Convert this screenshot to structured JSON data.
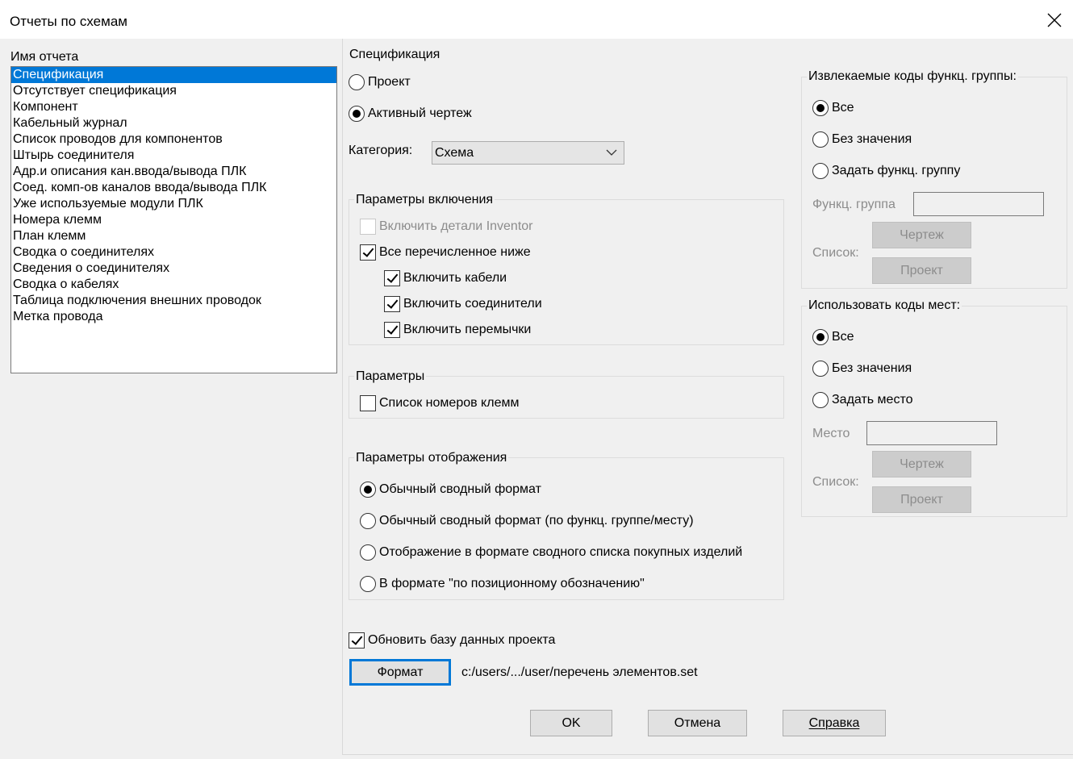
{
  "window": {
    "title": "Отчеты по схемам"
  },
  "report_list": {
    "label": "Имя отчета",
    "selected_index": 0,
    "items": [
      "Спецификация",
      "Отсутствует спецификация",
      "Компонент",
      "Кабельный журнал",
      "Список проводов для компонентов",
      "Штырь соединителя",
      "Адр.и описания кан.ввода/вывода ПЛК",
      "Соед. комп-ов каналов ввода/вывода ПЛК",
      "Уже используемые модули ПЛК",
      "Номера клемм",
      "План клемм",
      "Сводка о соединителях",
      "Сведения о соединителях",
      "Сводка о кабелях",
      "Таблица подключения внешних проводок",
      "Метка провода"
    ]
  },
  "spec": {
    "title": "Спецификация",
    "scope_project": "Проект",
    "scope_active": "Активный чертеж",
    "scope_selected": "active",
    "category_label": "Категория:",
    "category_value": "Схема"
  },
  "include": {
    "title": "Параметры включения",
    "inventor": "Включить детали Inventor",
    "inventor_checked": false,
    "all_below": "Все перечисленное ниже",
    "all_below_checked": true,
    "cables": "Включить кабели",
    "cables_checked": true,
    "connectors": "Включить соединители",
    "connectors_checked": true,
    "jumpers": "Включить перемычки",
    "jumpers_checked": true
  },
  "params": {
    "title": "Параметры",
    "terminal_numbers": "Список номеров клемм",
    "terminal_numbers_checked": false
  },
  "display": {
    "title": "Параметры отображения",
    "options": [
      "Обычный сводный формат",
      "Обычный сводный формат (по функц. группе/месту)",
      "Отображение в формате сводного списка покупных изделий",
      "В формате \"по позиционному обозначению\""
    ],
    "selected_index": 0
  },
  "update_db": {
    "label": "Обновить базу данных проекта",
    "checked": true
  },
  "format": {
    "button": "Формат",
    "path": "c:/users/.../user/перечень элементов.set"
  },
  "func_group": {
    "title": "Извлекаемые коды функц. группы:",
    "all": "Все",
    "none": "Без значения",
    "set": "Задать функц. группу",
    "selected": "all",
    "field_label": "Функц. группа",
    "field_value": "",
    "list_label": "Список:",
    "btn_drawing": "Чертеж",
    "btn_project": "Проект"
  },
  "location": {
    "title": "Использовать коды мест:",
    "all": "Все",
    "none": "Без значения",
    "set": "Задать место",
    "selected": "all",
    "field_label": "Место",
    "field_value": "",
    "list_label": "Список:",
    "btn_drawing": "Чертеж",
    "btn_project": "Проект"
  },
  "buttons": {
    "ok": "OK",
    "cancel": "Отмена",
    "help": "Справка"
  }
}
